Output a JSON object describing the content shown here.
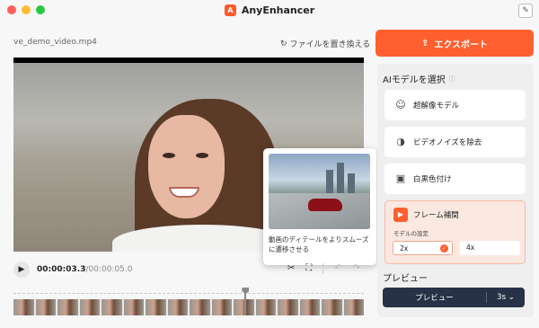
{
  "window": {
    "title": "AnyEnhancer",
    "traffic_lights": {
      "close": "#fe5f57",
      "minimize": "#febc2e",
      "maximize": "#28c840"
    }
  },
  "file": {
    "name": "ve_demo_video.mp4",
    "replace_label": "ファイルを置き換える"
  },
  "popup": {
    "text": "動画のディテールをよりスムーズに遷移させる"
  },
  "player": {
    "current_time": "00:00:03.3",
    "total_time": "/00:00:05.0",
    "progress": 0.66
  },
  "sidebar": {
    "export_label": "エクスポート",
    "ai_title": "AIモデルを選択",
    "models": [
      {
        "label": "超解像モデル",
        "icon": "robot-icon"
      },
      {
        "label": "ビデオノイズを除去",
        "icon": "denoise-icon"
      },
      {
        "label": "白黒色付け",
        "icon": "colorize-icon"
      }
    ],
    "active_model": {
      "label": "フレーム補間",
      "icon": "frame-interpolation-icon",
      "settings_label": "モデルの設定",
      "options": [
        "2x",
        "4x"
      ],
      "selected": "2x"
    },
    "preview": {
      "title": "プレビュー",
      "button_label": "プレビュー",
      "duration": "3s"
    }
  },
  "colors": {
    "accent": "#ff5f2e",
    "preview_button": "#273246"
  }
}
